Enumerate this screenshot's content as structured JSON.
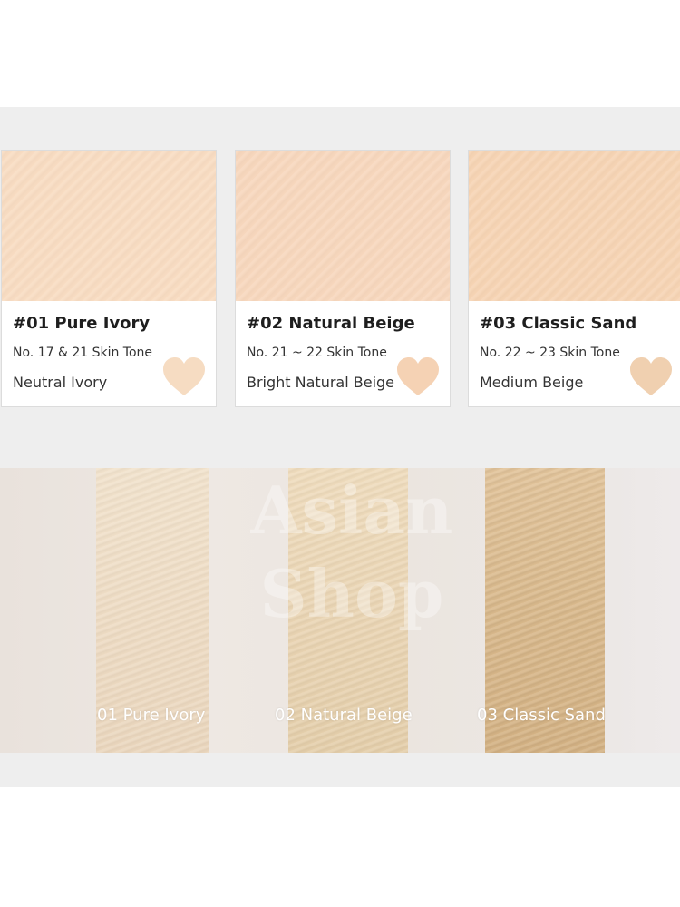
{
  "colors": {
    "pure_ivory": "#f8dcc2",
    "natural_beige": "#f7d7bd",
    "classic_sand": "#f6d4b4",
    "heart_ivory": "#f6dcc2",
    "heart_beige": "#f5d2b4",
    "heart_sand": "#f0d0b0"
  },
  "shades": [
    {
      "name": "#01 Pure Ivory",
      "tone": "No. 17 & 21 Skin Tone",
      "desc": "Neutral Ivory",
      "icon": "heart-icon"
    },
    {
      "name": "#02 Natural Beige",
      "tone": "No. 21 ~ 22 Skin Tone",
      "desc": "Bright Natural Beige",
      "icon": "heart-icon"
    },
    {
      "name": "#03 Classic Sand",
      "tone": "No. 22 ~ 23 Skin Tone",
      "desc": "Medium Beige",
      "icon": "heart-icon"
    }
  ],
  "swatch_labels": [
    "01 Pure Ivory",
    "02 Natural Beige",
    "03 Classic Sand"
  ],
  "watermark": {
    "line1": "Asian",
    "line2": "Shop"
  }
}
